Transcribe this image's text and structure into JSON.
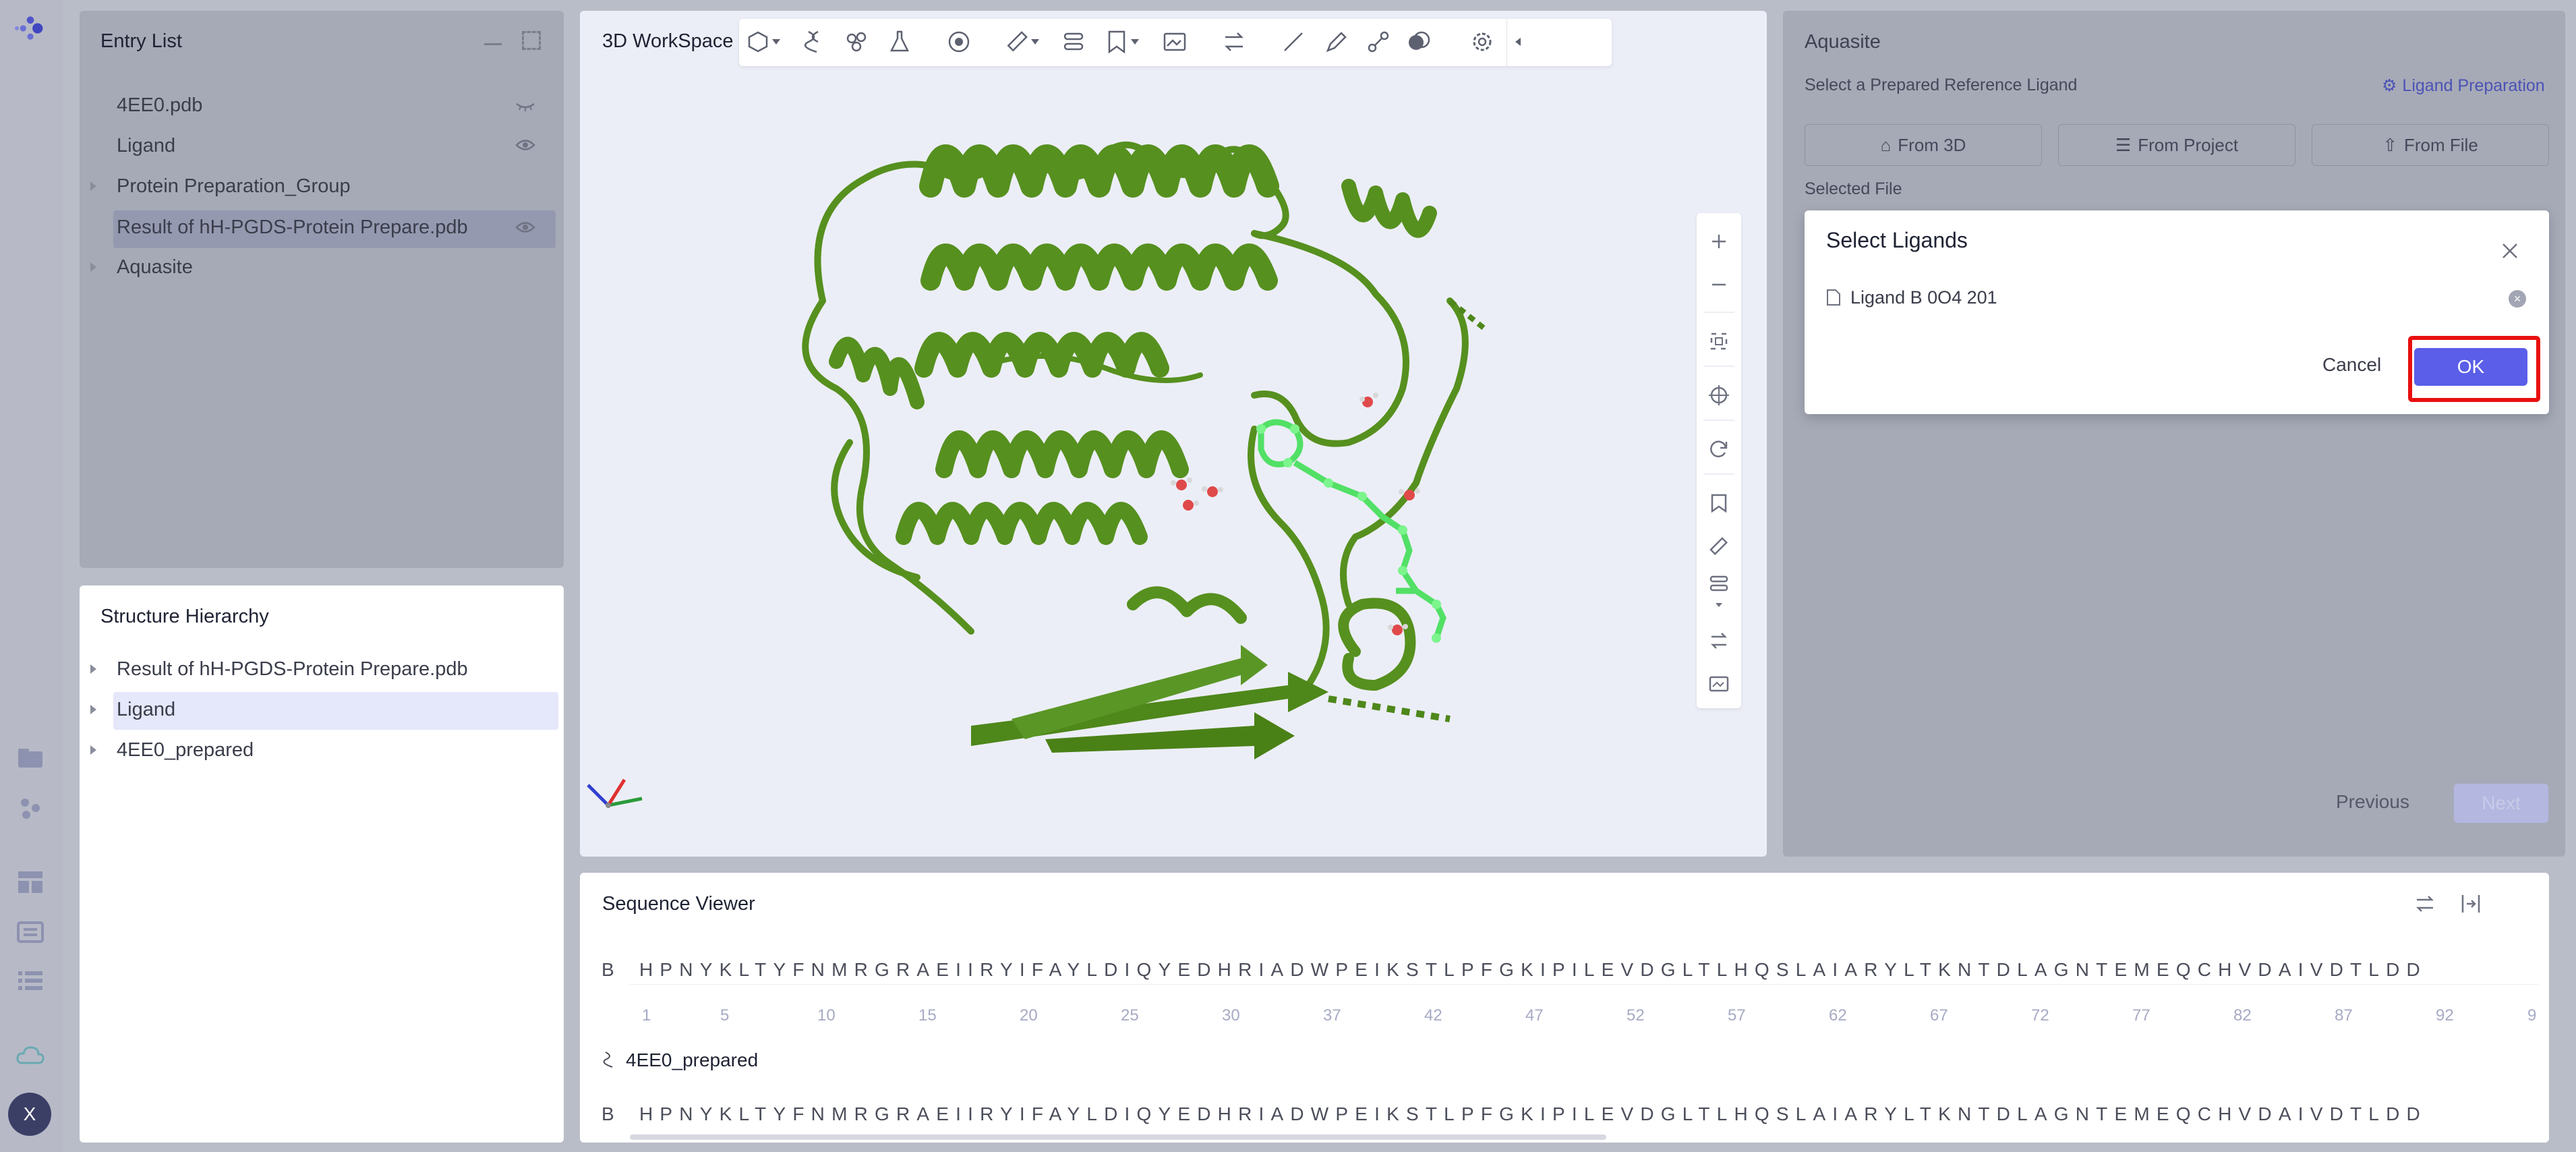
{
  "sidebar_rail": {
    "user_initial": "X"
  },
  "entry_list": {
    "title": "Entry List",
    "items": [
      {
        "label": "4EE0.pdb"
      },
      {
        "label": "Ligand"
      },
      {
        "label": "Protein Preparation_Group"
      },
      {
        "label": "Result of hH-PGDS-Protein Prepare.pdb"
      },
      {
        "label": "Aquasite"
      }
    ]
  },
  "structure_hierarchy": {
    "title": "Structure Hierarchy",
    "items": [
      {
        "label": "Result of hH-PGDS-Protein Prepare.pdb"
      },
      {
        "label": "Ligand"
      },
      {
        "label": "4EE0_prepared"
      }
    ]
  },
  "workspace": {
    "title": "3D WorkSpace",
    "accent_color": "#5b8c23"
  },
  "aquasite": {
    "title": "Aquasite",
    "select_label": "Select a Prepared Reference Ligand",
    "ligand_prep_link": "Ligand Preparation",
    "from_3d": "From 3D",
    "from_project": "From Project",
    "from_file": "From File",
    "selected_file_label": "Selected File",
    "previous_button": "Previous",
    "next_button": "Next"
  },
  "dialog": {
    "title": "Select Ligands",
    "ligand_item": "Ligand B 0O4 201",
    "cancel_label": "Cancel",
    "ok_label": "OK",
    "ok_color": "#5a5ee8",
    "highlight_color": "#e8100f"
  },
  "sequence_viewer": {
    "title": "Sequence Viewer",
    "chain_label": "B",
    "sequence": "HPNYKLTYFNMRGRAEIIRYIFAYLDIQYEDHRIADWPEIKSTLPFGKIPILEVDGLTLHQSLAIARYLTKNTDLAGNTEMEQCHVDAIVDTLDD",
    "ticks": [
      "1",
      "5",
      "10",
      "15",
      "20",
      "25",
      "30",
      "37",
      "42",
      "47",
      "52",
      "57",
      "62",
      "67",
      "72",
      "77",
      "82",
      "87",
      "92",
      "9"
    ],
    "group_label": "4EE0_prepared",
    "chain_label_2": "B"
  }
}
